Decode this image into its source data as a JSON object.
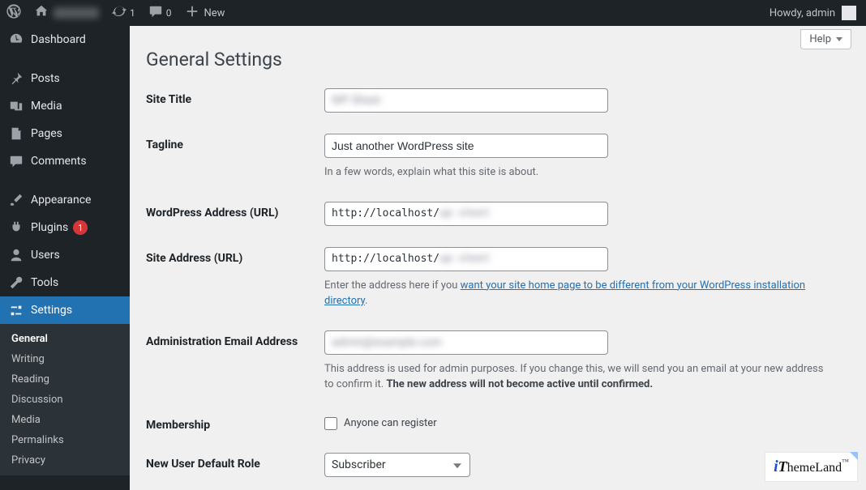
{
  "adminbar": {
    "updates_count": "1",
    "comments_count": "0",
    "new_label": "New",
    "howdy": "Howdy, admin"
  },
  "menu": {
    "dashboard": "Dashboard",
    "posts": "Posts",
    "media": "Media",
    "pages": "Pages",
    "comments": "Comments",
    "appearance": "Appearance",
    "plugins": "Plugins",
    "plugins_updates": "1",
    "users": "Users",
    "tools": "Tools",
    "settings": "Settings",
    "submenu": {
      "general": "General",
      "writing": "Writing",
      "reading": "Reading",
      "discussion": "Discussion",
      "media": "Media",
      "permalinks": "Permalinks",
      "privacy": "Privacy"
    }
  },
  "page": {
    "help": "Help",
    "title": "General Settings",
    "rows": {
      "site_title": {
        "label": "Site Title",
        "value": ""
      },
      "tagline": {
        "label": "Tagline",
        "value": "Just another WordPress site",
        "desc": "In a few words, explain what this site is about."
      },
      "wp_url": {
        "label": "WordPress Address (URL)",
        "value": "http://localhost/"
      },
      "site_url": {
        "label": "Site Address (URL)",
        "value": "http://localhost/",
        "desc_pre": "Enter the address here if you ",
        "desc_link": "want your site home page to be different from your WordPress installation directory",
        "desc_post": "."
      },
      "admin_email": {
        "label": "Administration Email Address",
        "value": "",
        "desc_pre": "This address is used for admin purposes. If you change this, we will send you an email at your new address to confirm it. ",
        "desc_strong": "The new address will not become active until confirmed."
      },
      "membership": {
        "label": "Membership",
        "checkbox_label": "Anyone can register"
      },
      "default_role": {
        "label": "New User Default Role",
        "value": "Subscriber"
      }
    }
  },
  "brand": {
    "name": "iThemeLand",
    "i": "i",
    "t": "T",
    "rest": "hemeLand",
    "tm": "™"
  }
}
